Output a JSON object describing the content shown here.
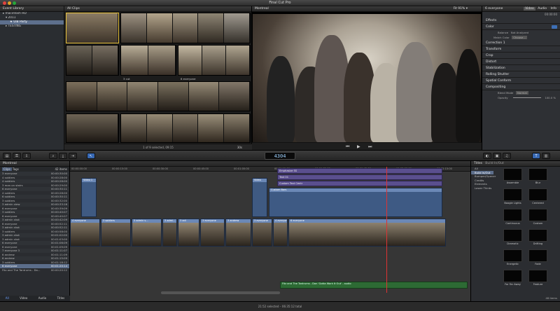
{
  "window": {
    "title": "Final Cut Pro"
  },
  "library": {
    "header": "Event Library",
    "items": [
      {
        "label": "macintosh HD",
        "selected": false
      },
      {
        "label": "2011",
        "selected": false
      },
      {
        "label": "UIB Party",
        "selected": true
      },
      {
        "label": "TESTING",
        "selected": false
      }
    ]
  },
  "browser": {
    "header": "All Clips",
    "strip_labels": [
      "3 cut",
      "6 everyone"
    ],
    "status": "1 of 9 selected, 09:15",
    "zoom": "30s"
  },
  "viewer": {
    "header": "Montreal",
    "zoom_label": "Fit",
    "zoom_value": "91%"
  },
  "inspector": {
    "clip_name": "6 everyone",
    "tabs": [
      "Video",
      "Audio",
      "Info"
    ],
    "timecode": "00:00:00",
    "sections": {
      "effects": "Effects",
      "color": "Color",
      "balance_label": "Balance",
      "balance_value": "Not Analyzed",
      "match_color_label": "Match Color",
      "match_color_value": "Choose...",
      "correction": "Correction 1",
      "transform": "Transform",
      "crop": "Crop",
      "distort": "Distort",
      "stabilization": "Stabilization",
      "rolling_shutter": "Rolling Shutter",
      "spatial_conform": "Spatial Conform",
      "compositing": "Compositing",
      "blend_mode_label": "Blend Mode",
      "blend_mode_value": "Normal",
      "opacity_label": "Opacity",
      "opacity_value": "100.0 %"
    }
  },
  "toolbar": {
    "timecode": "4304"
  },
  "index": {
    "project": "Montreal",
    "tabs": [
      "Clips",
      "Tags"
    ],
    "count": "42 items",
    "rows": [
      {
        "name": "3 everyone",
        "tc": "00:00:30:00"
      },
      {
        "name": "4 soldiers",
        "tc": "00:00:28:00"
      },
      {
        "name": "4 soldiers",
        "tc": "00:00:28:00"
      },
      {
        "name": "3 man on stairs",
        "tc": "00:00:29:00"
      },
      {
        "name": "6 everyone",
        "tc": "00:00:30:11"
      },
      {
        "name": "4 soldiers",
        "tc": "00:00:28:00"
      },
      {
        "name": "6 soldiers",
        "tc": "00:00:30:11"
      },
      {
        "name": "3 soldiers",
        "tc": "00:00:32:00"
      },
      {
        "name": "3 admin view",
        "tc": "00:00:33:16"
      },
      {
        "name": "6 everyone",
        "tc": "00:00:39:09"
      },
      {
        "name": "3 soldiers",
        "tc": "00:00:40:07"
      },
      {
        "name": "6 everyone",
        "tc": "00:00:40:07"
      },
      {
        "name": "3 admin shot",
        "tc": "00:00:42:09"
      },
      {
        "name": "6 everyone",
        "tc": "00:00:52:11"
      },
      {
        "name": "3 admin shot",
        "tc": "00:00:52:11"
      },
      {
        "name": "3 soldiers",
        "tc": "00:00:58:00"
      },
      {
        "name": "3 admin shot",
        "tc": "00:01:02:00"
      },
      {
        "name": "3 admin shot",
        "tc": "00:01:03:00"
      },
      {
        "name": "6 everyone",
        "tc": "00:01:06:09"
      },
      {
        "name": "6 everyone",
        "tc": "00:01:09:09"
      },
      {
        "name": "7 everyone 3",
        "tc": "00:01:11:07"
      },
      {
        "name": "6 andrew",
        "tc": "00:01:11:09"
      },
      {
        "name": "6 andrew",
        "tc": "00:01:15:09"
      },
      {
        "name": "3 soldiers",
        "tc": "00:01:18:12"
      },
      {
        "name": "6 everyone",
        "tc": "00:01:20:14",
        "selected": true
      },
      {
        "name": "Fitz and The Tantrums - Do...",
        "tc": "00:00:20:12"
      }
    ],
    "filters": [
      "All",
      "Video",
      "Audio",
      "Titles"
    ]
  },
  "timeline": {
    "ruler": [
      "00:00:00:00",
      "00:00:15:00",
      "00:00:30:00",
      "00:00:45:00",
      "00:01:00:00",
      "00:01:15:00",
      "00:01:30:00",
      "00:01:45:00",
      "00:02:00:00",
      "00:02:15:00"
    ],
    "connected_clips": [
      "Video 1",
      "Video"
    ],
    "title_clips": [
      "Emphasize SS",
      "Text 01",
      "Custom Text Centr",
      "Custom Bars"
    ],
    "storyline_labels": [
      "4 everyone",
      "3 soldiers",
      "3 admin s...",
      "3 admi...",
      "3 adi",
      "3 everyone",
      "3 andrew",
      "3 everyone",
      "4 everyone",
      "6 everyone"
    ],
    "audio_clip": "Fitz and The Tantrums - Don 'Gotta Work It Out' - audio"
  },
  "titles_browser": {
    "header": "Titles",
    "subheader": "Build In/Out",
    "categories": [
      {
        "label": "All",
        "selected": false
      },
      {
        "label": "Build In/Out",
        "selected": true
      },
      {
        "label": "Bumper/Opener",
        "selected": false
      },
      {
        "label": "Credits",
        "selected": false
      },
      {
        "label": "Elements",
        "selected": false
      },
      {
        "label": "Lower Thirds",
        "selected": false
      }
    ],
    "tiles": [
      "Assemble",
      "Blur",
      "Boogie Lights",
      "Centered",
      "Continuous",
      "Custom",
      "Dramatic",
      "Drifting",
      "Energetic",
      "Fade",
      "Far Far Away",
      "Feature"
    ],
    "count": "48 items"
  },
  "status": {
    "text": "21:52 selected – 06:35:12 total"
  }
}
